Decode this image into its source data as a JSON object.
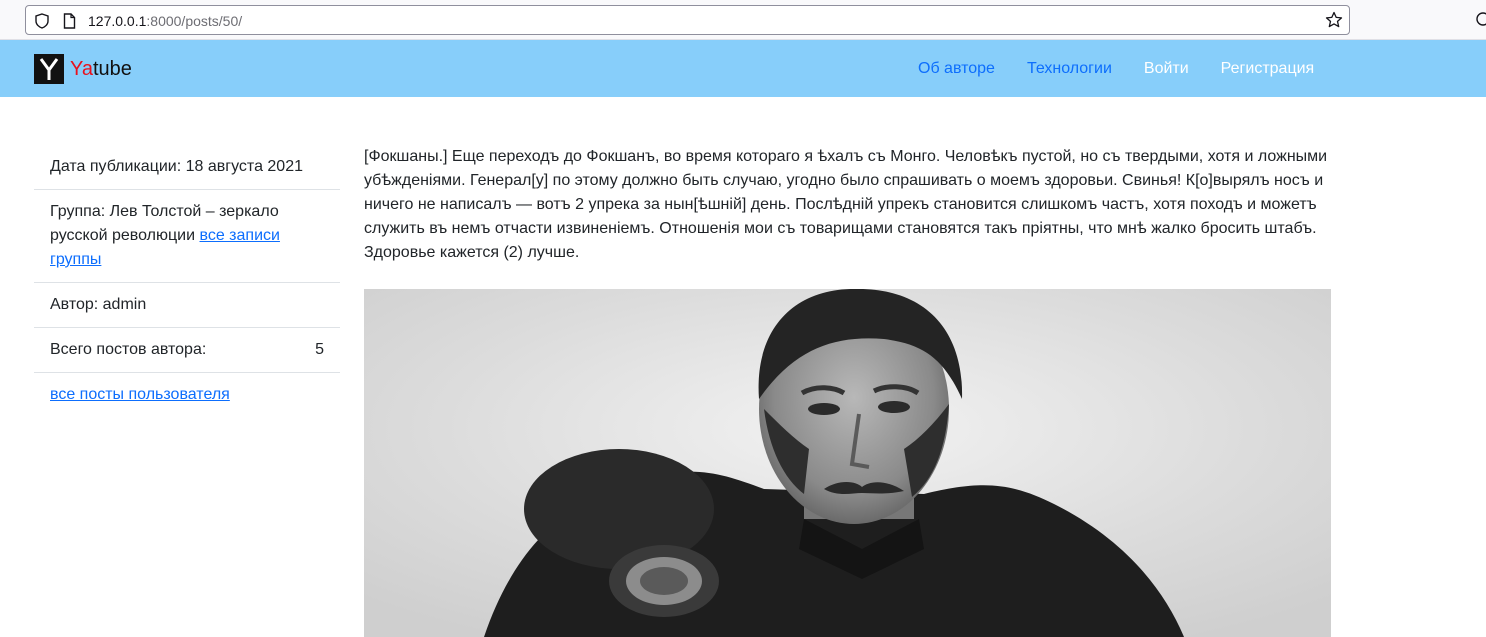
{
  "browser": {
    "url_host": "127.0.0.1",
    "url_rest": ":8000/posts/50/"
  },
  "navbar": {
    "brand_prefix": "Ya",
    "brand_suffix": "tube",
    "links": [
      {
        "label": "Об авторе"
      },
      {
        "label": "Технологии"
      },
      {
        "label": "Войти"
      },
      {
        "label": "Регистрация"
      }
    ]
  },
  "sidebar": {
    "pub_date": "Дата публикации: 18 августа 2021",
    "group_text": "Группа: Лев Толстой – зеркало русской революции",
    "group_link": "все записи группы",
    "author": "Автор: admin",
    "posts_count_label": "Всего постов автора:",
    "posts_count_value": "5",
    "all_posts_link": "все посты пользователя"
  },
  "post": {
    "text": "[Фокшаны.] Еще переходъ до Фокшанъ, во время котораго я ѣхалъ съ Монго. Человѣкъ пустой, но съ твердыми, хотя и ложными убѣжденiями. Генерал[у] по этому должно быть случаю, угодно было спрашивать о моемъ здоровьи. Свинья! К[о]вырялъ носъ и ничего не написалъ — вотъ 2 упрека за нын[ѣшнiй] день. Послѣднiй упрекъ становится слишкомъ частъ, хотя походъ и можетъ служить въ немъ отчасти извиненiемъ. Отношенiя мои съ товарищами становятся такъ прiятны, что мнѣ жалко бросить штабъ. Здоровье кажется (2) лучше."
  }
}
